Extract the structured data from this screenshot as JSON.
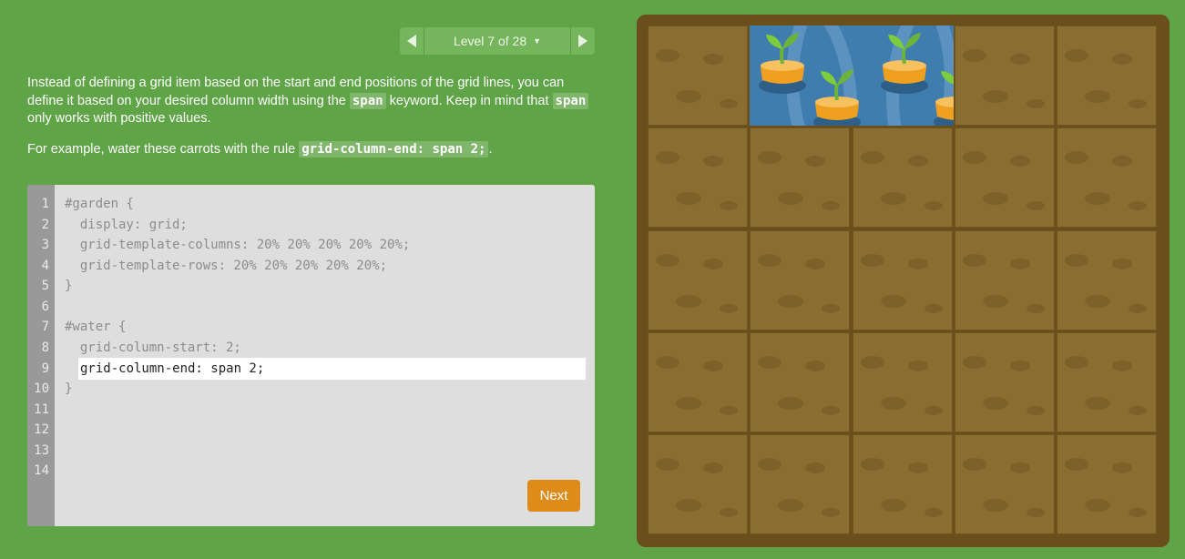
{
  "level_nav": {
    "label": "Level 7 of 28",
    "prev_icon": "triangle-left-icon",
    "next_icon": "triangle-right-icon",
    "caret_icon": "caret-down-icon"
  },
  "instructions": {
    "p1_a": "Instead of defining a grid item based on the start and end positions of the grid lines, you can define it based on your desired column width using the ",
    "p1_code1": "span",
    "p1_b": " keyword. Keep in mind that ",
    "p1_code2": "span",
    "p1_c": " only works with positive values.",
    "p2_a": "For example, water these carrots with the rule ",
    "p2_code": "grid-column-end: span 2;",
    "p2_b": "."
  },
  "editor": {
    "line_numbers": [
      "1",
      "2",
      "3",
      "4",
      "5",
      "6",
      "7",
      "8",
      "9",
      "10",
      "11",
      "12",
      "13",
      "14"
    ],
    "lines": [
      "#garden {",
      "  display: grid;",
      "  grid-template-columns: 20% 20% 20% 20% 20%;",
      "  grid-template-rows: 20% 20% 20% 20% 20%;",
      "}",
      "",
      "#water {",
      "  grid-column-start: 2;",
      "",
      "}"
    ],
    "input_value": "grid-column-end: span 2;",
    "next_label": "Next"
  },
  "garden": {
    "columns": 5,
    "rows": 5,
    "water_area": "columns 2 to 3, row 1",
    "carrot_count": 4
  },
  "colors": {
    "background": "#5fa446",
    "soil": "#8a6d31",
    "water": "#3f7dae",
    "carrot": "#f0a020",
    "next_button": "#dd8c1a"
  }
}
